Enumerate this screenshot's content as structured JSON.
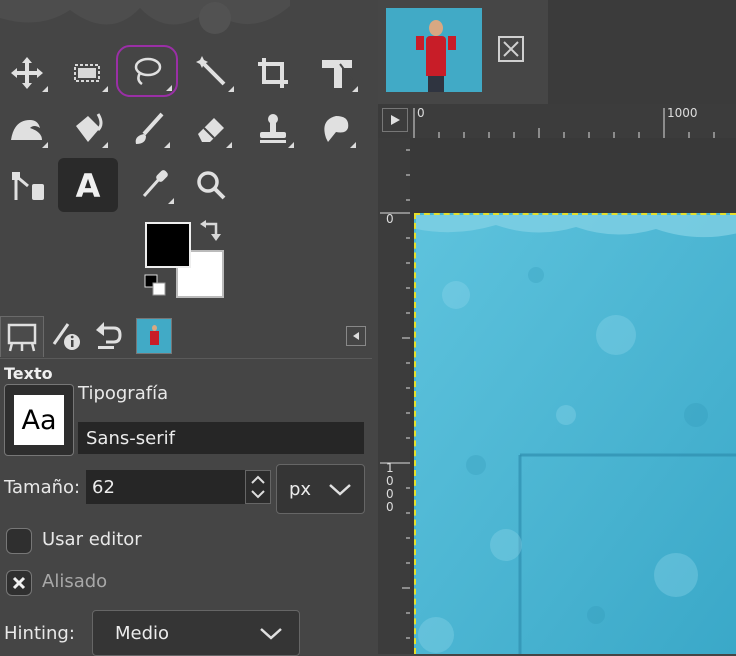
{
  "toolbox": {
    "tools": [
      {
        "icon": "move-icon"
      },
      {
        "icon": "rect-select-icon"
      },
      {
        "icon": "lasso-icon",
        "active": true
      },
      {
        "icon": "magic-wand-icon"
      },
      {
        "icon": "crop-icon"
      },
      {
        "icon": "transform-icon"
      },
      {
        "icon": "warp-icon"
      },
      {
        "icon": "bucket-fill-icon"
      },
      {
        "icon": "paintbrush-icon"
      },
      {
        "icon": "eraser-icon"
      },
      {
        "icon": "clone-stamp-icon"
      },
      {
        "icon": "smudge-icon"
      },
      {
        "icon": "paths-icon"
      },
      {
        "icon": "text-tool-icon",
        "active": true,
        "label": "A"
      },
      {
        "icon": "color-picker-icon"
      },
      {
        "icon": "zoom-icon"
      }
    ],
    "foreground_color": "#000000",
    "background_color": "#ffffff"
  },
  "tool_options": {
    "title": "Texto",
    "font_label": "Tipografía",
    "font_preview": "Aa",
    "font_value": "Sans-serif",
    "size_label": "Tamaño:",
    "size_value": "62",
    "unit_value": "px",
    "use_editor_label": "Usar editor",
    "antialias_label": "Alisado",
    "hinting_label": "Hinting:",
    "hinting_value": "Medio"
  },
  "rulers": {
    "h_labels": [
      "0",
      "1000"
    ],
    "v_labels": [
      "0",
      "1",
      "0",
      "0",
      "0"
    ]
  },
  "colors": {
    "accent_lasso": "#9a2fa6",
    "selection_dash": "#e6df2a",
    "photo_blue": "#49b6d4"
  }
}
